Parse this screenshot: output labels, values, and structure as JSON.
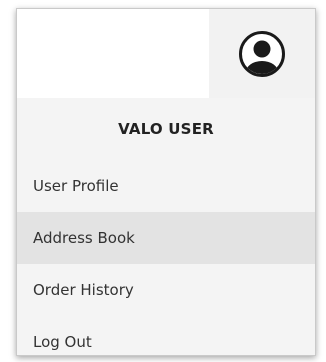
{
  "header": {
    "avatar_icon": "user-circle-icon"
  },
  "user": {
    "name": "VALO USER"
  },
  "menu": {
    "items": [
      {
        "label": "User Profile"
      },
      {
        "label": "Address Book"
      },
      {
        "label": "Order History"
      },
      {
        "label": "Log Out"
      }
    ],
    "hovered": "Address Book"
  },
  "colors": {
    "panel_bg": "#f4f4f4",
    "hover_bg": "#e3e3e3",
    "avatar_ring": "#1a1a1a"
  }
}
